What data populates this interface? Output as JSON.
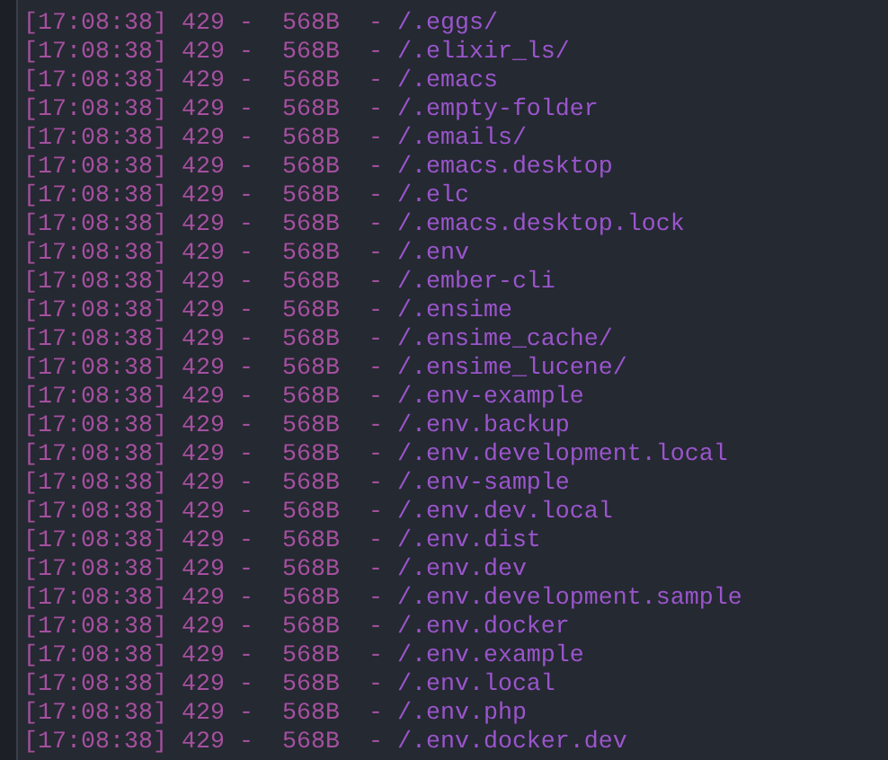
{
  "terminal": {
    "lines": [
      {
        "time": "[17:08:38]",
        "status": "429",
        "sep1": "-",
        "size": "568B",
        "sep2": "-",
        "path": "/.eggs/"
      },
      {
        "time": "[17:08:38]",
        "status": "429",
        "sep1": "-",
        "size": "568B",
        "sep2": "-",
        "path": "/.elixir_ls/"
      },
      {
        "time": "[17:08:38]",
        "status": "429",
        "sep1": "-",
        "size": "568B",
        "sep2": "-",
        "path": "/.emacs"
      },
      {
        "time": "[17:08:38]",
        "status": "429",
        "sep1": "-",
        "size": "568B",
        "sep2": "-",
        "path": "/.empty-folder"
      },
      {
        "time": "[17:08:38]",
        "status": "429",
        "sep1": "-",
        "size": "568B",
        "sep2": "-",
        "path": "/.emails/"
      },
      {
        "time": "[17:08:38]",
        "status": "429",
        "sep1": "-",
        "size": "568B",
        "sep2": "-",
        "path": "/.emacs.desktop"
      },
      {
        "time": "[17:08:38]",
        "status": "429",
        "sep1": "-",
        "size": "568B",
        "sep2": "-",
        "path": "/.elc"
      },
      {
        "time": "[17:08:38]",
        "status": "429",
        "sep1": "-",
        "size": "568B",
        "sep2": "-",
        "path": "/.emacs.desktop.lock"
      },
      {
        "time": "[17:08:38]",
        "status": "429",
        "sep1": "-",
        "size": "568B",
        "sep2": "-",
        "path": "/.env"
      },
      {
        "time": "[17:08:38]",
        "status": "429",
        "sep1": "-",
        "size": "568B",
        "sep2": "-",
        "path": "/.ember-cli"
      },
      {
        "time": "[17:08:38]",
        "status": "429",
        "sep1": "-",
        "size": "568B",
        "sep2": "-",
        "path": "/.ensime"
      },
      {
        "time": "[17:08:38]",
        "status": "429",
        "sep1": "-",
        "size": "568B",
        "sep2": "-",
        "path": "/.ensime_cache/"
      },
      {
        "time": "[17:08:38]",
        "status": "429",
        "sep1": "-",
        "size": "568B",
        "sep2": "-",
        "path": "/.ensime_lucene/"
      },
      {
        "time": "[17:08:38]",
        "status": "429",
        "sep1": "-",
        "size": "568B",
        "sep2": "-",
        "path": "/.env-example"
      },
      {
        "time": "[17:08:38]",
        "status": "429",
        "sep1": "-",
        "size": "568B",
        "sep2": "-",
        "path": "/.env.backup"
      },
      {
        "time": "[17:08:38]",
        "status": "429",
        "sep1": "-",
        "size": "568B",
        "sep2": "-",
        "path": "/.env.development.local"
      },
      {
        "time": "[17:08:38]",
        "status": "429",
        "sep1": "-",
        "size": "568B",
        "sep2": "-",
        "path": "/.env-sample"
      },
      {
        "time": "[17:08:38]",
        "status": "429",
        "sep1": "-",
        "size": "568B",
        "sep2": "-",
        "path": "/.env.dev.local"
      },
      {
        "time": "[17:08:38]",
        "status": "429",
        "sep1": "-",
        "size": "568B",
        "sep2": "-",
        "path": "/.env.dist"
      },
      {
        "time": "[17:08:38]",
        "status": "429",
        "sep1": "-",
        "size": "568B",
        "sep2": "-",
        "path": "/.env.dev"
      },
      {
        "time": "[17:08:38]",
        "status": "429",
        "sep1": "-",
        "size": "568B",
        "sep2": "-",
        "path": "/.env.development.sample"
      },
      {
        "time": "[17:08:38]",
        "status": "429",
        "sep1": "-",
        "size": "568B",
        "sep2": "-",
        "path": "/.env.docker"
      },
      {
        "time": "[17:08:38]",
        "status": "429",
        "sep1": "-",
        "size": "568B",
        "sep2": "-",
        "path": "/.env.example"
      },
      {
        "time": "[17:08:38]",
        "status": "429",
        "sep1": "-",
        "size": "568B",
        "sep2": "-",
        "path": "/.env.local"
      },
      {
        "time": "[17:08:38]",
        "status": "429",
        "sep1": "-",
        "size": "568B",
        "sep2": "-",
        "path": "/.env.php"
      },
      {
        "time": "[17:08:38]",
        "status": "429",
        "sep1": "-",
        "size": "568B",
        "sep2": "-",
        "path": "/.env.docker.dev"
      }
    ]
  }
}
